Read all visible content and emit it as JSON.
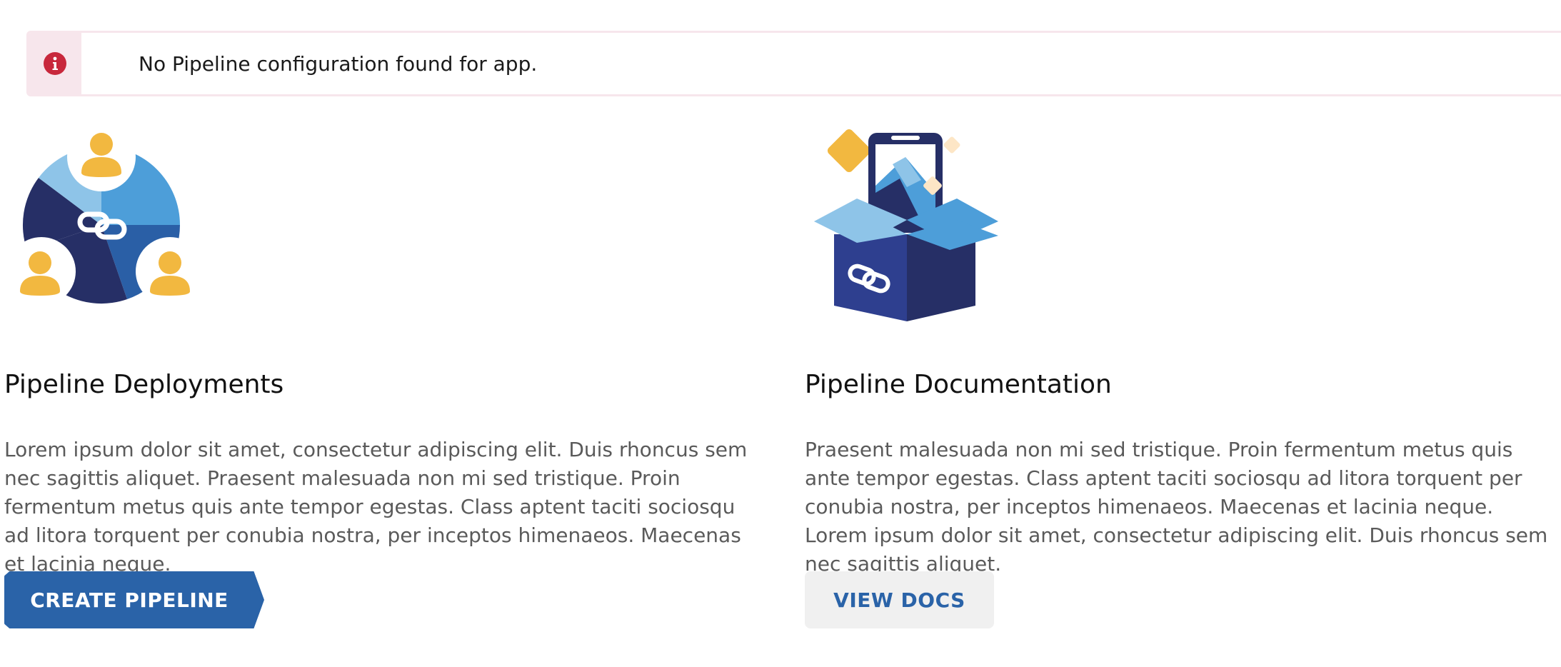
{
  "alert": {
    "icon": "info-icon",
    "message": "No Pipeline configuration found for app.",
    "color": "#c8283c"
  },
  "cards": [
    {
      "illustration": "team-link-icon",
      "title": "Pipeline Deployments",
      "description": "Lorem ipsum dolor sit amet, consectetur adipiscing elit. Duis rhoncus sem nec sagittis aliquet. Praesent malesuada non mi sed tristique. Proin fermentum metus quis ante tempor egestas. Class aptent taciti sociosqu ad litora torquent per conubia nostra, per inceptos himenaeos. Maecenas et lacinia neque.",
      "button_label": "CREATE PIPELINE"
    },
    {
      "illustration": "box-phone-icon",
      "title": "Pipeline Documentation",
      "description": "Praesent malesuada non mi sed tristique. Proin fermentum metus quis ante tempor egestas. Class aptent taciti sociosqu ad litora torquent per conubia nostra, per inceptos himenaeos. Maecenas et lacinia neque. Lorem ipsum dolor sit amet, consectetur adipiscing elit. Duis rhoncus sem nec sagittis aliquet.",
      "button_label": "VIEW DOCS"
    }
  ],
  "colors": {
    "primary": "#2a63a8",
    "navy": "#262f66",
    "mid_blue": "#4d9ed9",
    "light_blue": "#8ec4e8",
    "yellow": "#f2b840",
    "alert_bg": "#f7e6ec"
  }
}
